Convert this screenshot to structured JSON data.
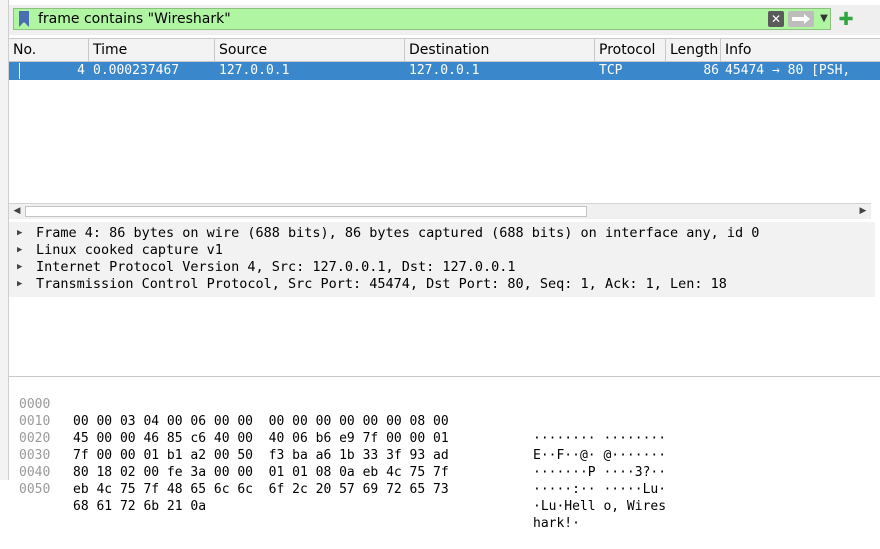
{
  "filter": {
    "expression": "frame contains \"Wireshark\"",
    "clear_icon": "clear-x-icon",
    "apply_icon": "apply-arrow-icon",
    "dropdown_icon": "chevron-down-icon",
    "add_icon": "plus-icon",
    "valid_color": "#aff5a2"
  },
  "packet_list": {
    "columns": [
      "No.",
      "Time",
      "Source",
      "Destination",
      "Protocol",
      "Length",
      "Info"
    ],
    "rows": [
      {
        "no": "4",
        "time": "0.000237467",
        "source": "127.0.0.1",
        "destination": "127.0.0.1",
        "protocol": "TCP",
        "length": "86",
        "info": "45474 → 80 [PSH,"
      }
    ],
    "selected_color": "#3a87cc"
  },
  "details": [
    "Frame 4: 86 bytes on wire (688 bits), 86 bytes captured (688 bits) on interface any, id 0",
    "Linux cooked capture v1",
    "Internet Protocol Version 4, Src: 127.0.0.1, Dst: 127.0.0.1",
    "Transmission Control Protocol, Src Port: 45474, Dst Port: 80, Seq: 1, Ack: 1, Len: 18"
  ],
  "bytes": [
    {
      "offset": "0000",
      "hex": "00 00 03 04 00 06 00 00  00 00 00 00 00 00 08 00",
      "ascii": "········ ········"
    },
    {
      "offset": "0010",
      "hex": "45 00 00 46 85 c6 40 00  40 06 b6 e9 7f 00 00 01",
      "ascii": "E··F··@· @·······"
    },
    {
      "offset": "0020",
      "hex": "7f 00 00 01 b1 a2 00 50  f3 ba a6 1b 33 3f 93 ad",
      "ascii": "·······P ····3?··"
    },
    {
      "offset": "0030",
      "hex": "80 18 02 00 fe 3a 00 00  01 01 08 0a eb 4c 75 7f",
      "ascii": "·····:·· ·····Lu·"
    },
    {
      "offset": "0040",
      "hex": "eb 4c 75 7f 48 65 6c 6c  6f 2c 20 57 69 72 65 73",
      "ascii": "·Lu·Hell o, Wires"
    },
    {
      "offset": "0050",
      "hex": "68 61 72 6b 21 0a",
      "ascii": "hark!·"
    }
  ]
}
